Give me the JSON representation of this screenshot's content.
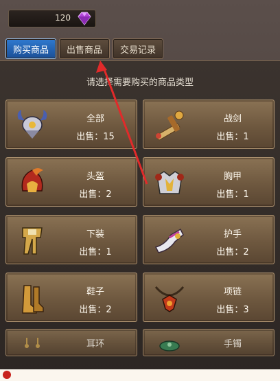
{
  "currency": {
    "amount": "120",
    "icon": "purple-gem-icon",
    "color": "#c45ae0"
  },
  "tabs": [
    {
      "label": "购买商品",
      "active": true
    },
    {
      "label": "出售商品",
      "active": false
    },
    {
      "label": "交易记录",
      "active": false
    }
  ],
  "panel": {
    "title": "请选择需要购买的商品类型"
  },
  "categories": [
    {
      "name": "全部",
      "sale": "出售：15",
      "icon": "helmet-crown-icon"
    },
    {
      "name": "战剑",
      "sale": "出售：1",
      "icon": "sword-icon"
    },
    {
      "name": "头盔",
      "sale": "出售：2",
      "icon": "helmet-icon"
    },
    {
      "name": "胸甲",
      "sale": "出售：1",
      "icon": "chest-armor-icon"
    },
    {
      "name": "下装",
      "sale": "出售：1",
      "icon": "leg-armor-icon"
    },
    {
      "name": "护手",
      "sale": "出售：2",
      "icon": "gauntlet-icon"
    },
    {
      "name": "鞋子",
      "sale": "出售：2",
      "icon": "boots-icon"
    },
    {
      "name": "项链",
      "sale": "出售：3",
      "icon": "necklace-icon"
    },
    {
      "name": "耳环",
      "icon": "earring-icon"
    },
    {
      "name": "手镯",
      "icon": "bracelet-icon"
    }
  ],
  "annotation": {
    "color": "#e12a2a"
  }
}
